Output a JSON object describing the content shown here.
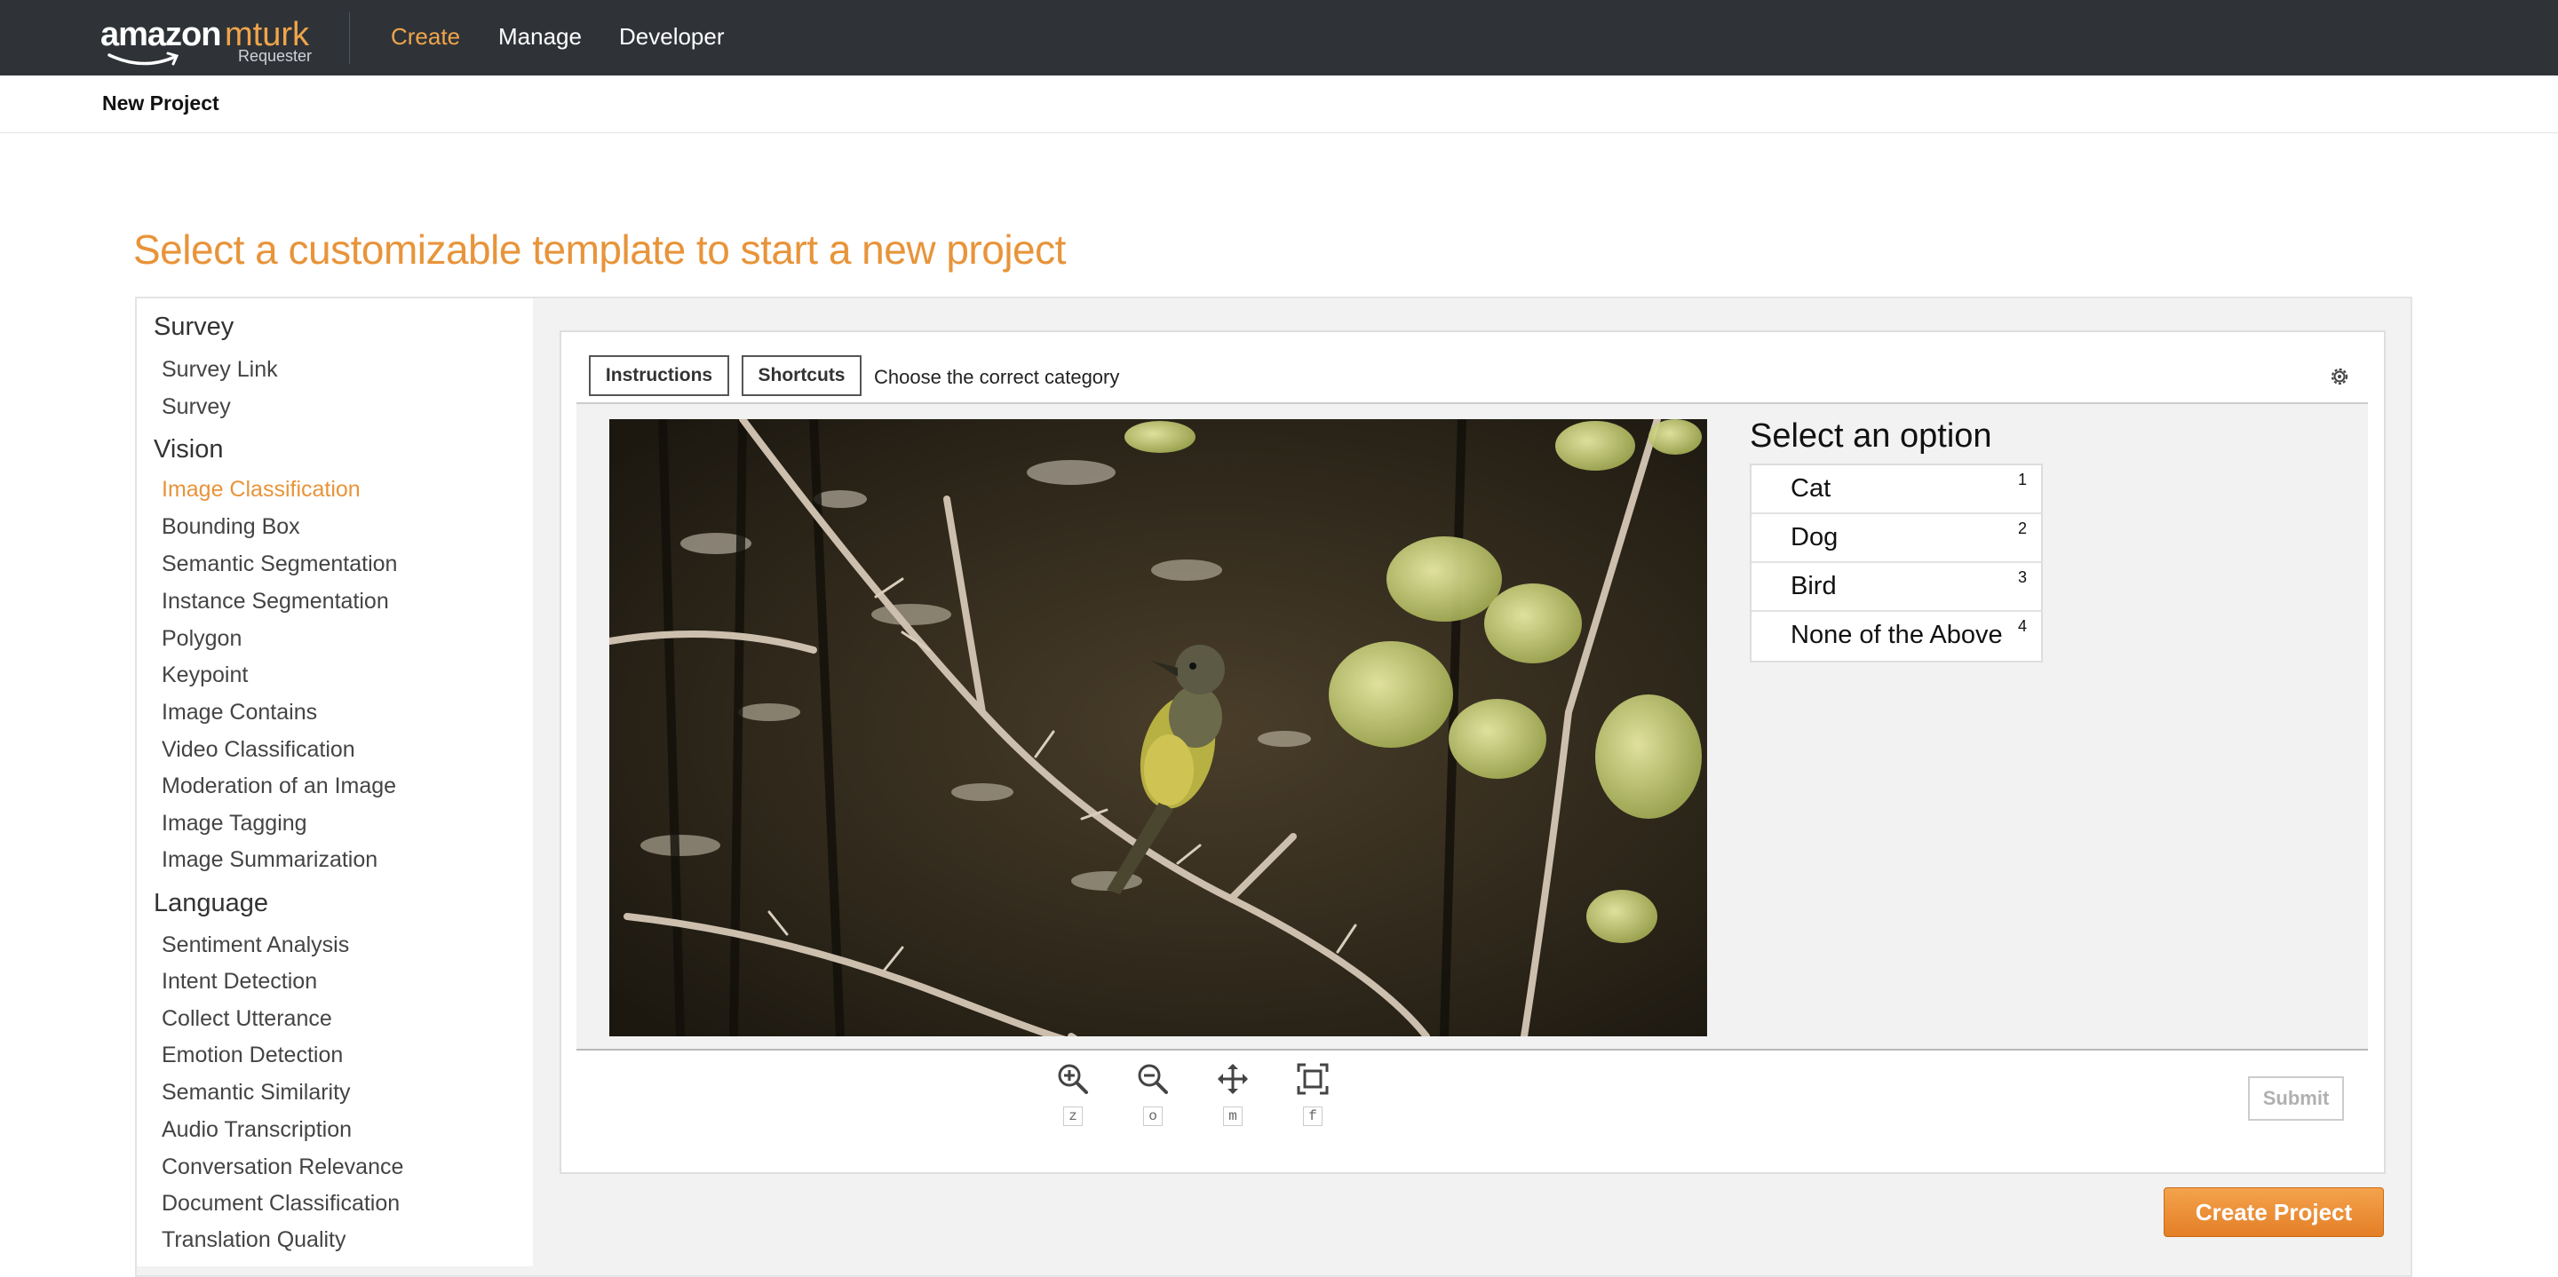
{
  "app": {
    "logo_amazon": "amazon",
    "logo_mturk": "mturk",
    "logo_sub": "Requester"
  },
  "nav": {
    "items": [
      {
        "label": "Create",
        "active": true
      },
      {
        "label": "Manage",
        "active": false
      },
      {
        "label": "Developer",
        "active": false
      }
    ]
  },
  "subheader": {
    "title": "New Project"
  },
  "page": {
    "heading": "Select a customizable template to start a new project"
  },
  "sidebar": {
    "categories": [
      {
        "name": "Survey",
        "items": [
          "Survey Link",
          "Survey"
        ]
      },
      {
        "name": "Vision",
        "items": [
          "Image Classification",
          "Bounding Box",
          "Semantic Segmentation",
          "Instance Segmentation",
          "Polygon",
          "Keypoint",
          "Image Contains",
          "Video Classification",
          "Moderation of an Image",
          "Image Tagging",
          "Image Summarization"
        ]
      },
      {
        "name": "Language",
        "items": [
          "Sentiment Analysis",
          "Intent Detection",
          "Collect Utterance",
          "Emotion Detection",
          "Semantic Similarity",
          "Audio Transcription",
          "Conversation Relevance",
          "Document Classification",
          "Translation Quality"
        ]
      }
    ],
    "selected": "Image Classification"
  },
  "preview": {
    "instructions_label": "Instructions",
    "shortcuts_label": "Shortcuts",
    "instruction_text": "Choose the correct category",
    "select_title": "Select an option",
    "options": [
      {
        "label": "Cat",
        "key": "1"
      },
      {
        "label": "Dog",
        "key": "2"
      },
      {
        "label": "Bird",
        "key": "3"
      },
      {
        "label": "None of the Above",
        "key": "4"
      }
    ],
    "tools": [
      {
        "icon": "zoom-in-icon",
        "key": "z"
      },
      {
        "icon": "zoom-out-icon",
        "key": "o"
      },
      {
        "icon": "move-icon",
        "key": "m"
      },
      {
        "icon": "fit-screen-icon",
        "key": "f"
      }
    ],
    "submit_label": "Submit"
  },
  "actions": {
    "create_project_label": "Create Project"
  },
  "colors": {
    "accent": "#e8943a",
    "nav_bg": "#2f3338",
    "button_orange": "#ec8c32"
  }
}
